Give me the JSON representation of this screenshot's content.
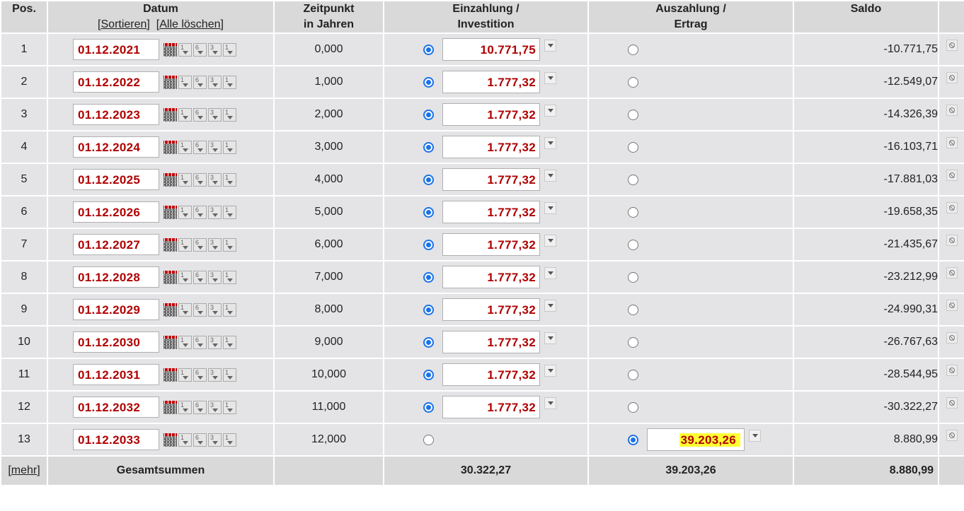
{
  "header": {
    "pos": "Pos.",
    "datum": "Datum",
    "sortieren": "Sortieren",
    "alle_loeschen": "Alle löschen",
    "zeitpunkt_1": "Zeitpunkt",
    "zeitpunkt_2": "in Jahren",
    "einzahlung_1": "Einzahlung /",
    "einzahlung_2": "Investition",
    "auszahlung_1": "Auszahlung /",
    "auszahlung_2": "Ertrag",
    "saldo": "Saldo"
  },
  "rows": [
    {
      "pos": "1",
      "date": "01.12.2021",
      "years": "0,000",
      "type": "einzahlung",
      "amount": "10.771,75",
      "saldo": "-10.771,75"
    },
    {
      "pos": "2",
      "date": "01.12.2022",
      "years": "1,000",
      "type": "einzahlung",
      "amount": "1.777,32",
      "saldo": "-12.549,07"
    },
    {
      "pos": "3",
      "date": "01.12.2023",
      "years": "2,000",
      "type": "einzahlung",
      "amount": "1.777,32",
      "saldo": "-14.326,39"
    },
    {
      "pos": "4",
      "date": "01.12.2024",
      "years": "3,000",
      "type": "einzahlung",
      "amount": "1.777,32",
      "saldo": "-16.103,71"
    },
    {
      "pos": "5",
      "date": "01.12.2025",
      "years": "4,000",
      "type": "einzahlung",
      "amount": "1.777,32",
      "saldo": "-17.881,03"
    },
    {
      "pos": "6",
      "date": "01.12.2026",
      "years": "5,000",
      "type": "einzahlung",
      "amount": "1.777,32",
      "saldo": "-19.658,35"
    },
    {
      "pos": "7",
      "date": "01.12.2027",
      "years": "6,000",
      "type": "einzahlung",
      "amount": "1.777,32",
      "saldo": "-21.435,67"
    },
    {
      "pos": "8",
      "date": "01.12.2028",
      "years": "7,000",
      "type": "einzahlung",
      "amount": "1.777,32",
      "saldo": "-23.212,99"
    },
    {
      "pos": "9",
      "date": "01.12.2029",
      "years": "8,000",
      "type": "einzahlung",
      "amount": "1.777,32",
      "saldo": "-24.990,31"
    },
    {
      "pos": "10",
      "date": "01.12.2030",
      "years": "9,000",
      "type": "einzahlung",
      "amount": "1.777,32",
      "saldo": "-26.767,63"
    },
    {
      "pos": "11",
      "date": "01.12.2031",
      "years": "10,000",
      "type": "einzahlung",
      "amount": "1.777,32",
      "saldo": "-28.544,95"
    },
    {
      "pos": "12",
      "date": "01.12.2032",
      "years": "11,000",
      "type": "einzahlung",
      "amount": "1.777,32",
      "saldo": "-30.322,27"
    },
    {
      "pos": "13",
      "date": "01.12.2033",
      "years": "12,000",
      "type": "auszahlung",
      "amount": "39.203,26",
      "saldo": "8.880,99"
    }
  ],
  "tools": [
    {
      "name": "calendar-icon",
      "label": ""
    },
    {
      "name": "day-step-icon",
      "label": "1"
    },
    {
      "name": "month-step-icon",
      "label": "6"
    },
    {
      "name": "quarter-step-icon",
      "label": "3"
    },
    {
      "name": "year-step-icon",
      "label": "1"
    }
  ],
  "footer": {
    "mehr": "mehr",
    "gesamtsummen": "Gesamtsummen",
    "sum_einzahlung": "30.322,27",
    "sum_auszahlung": "39.203,26",
    "sum_saldo": "8.880,99"
  },
  "colors": {
    "header_bg": "#d9d9d9",
    "row_bg": "#e4e3e6",
    "value_red": "#b00000",
    "radio_blue": "#1a73e8",
    "highlight_yellow": "#ffff33"
  }
}
